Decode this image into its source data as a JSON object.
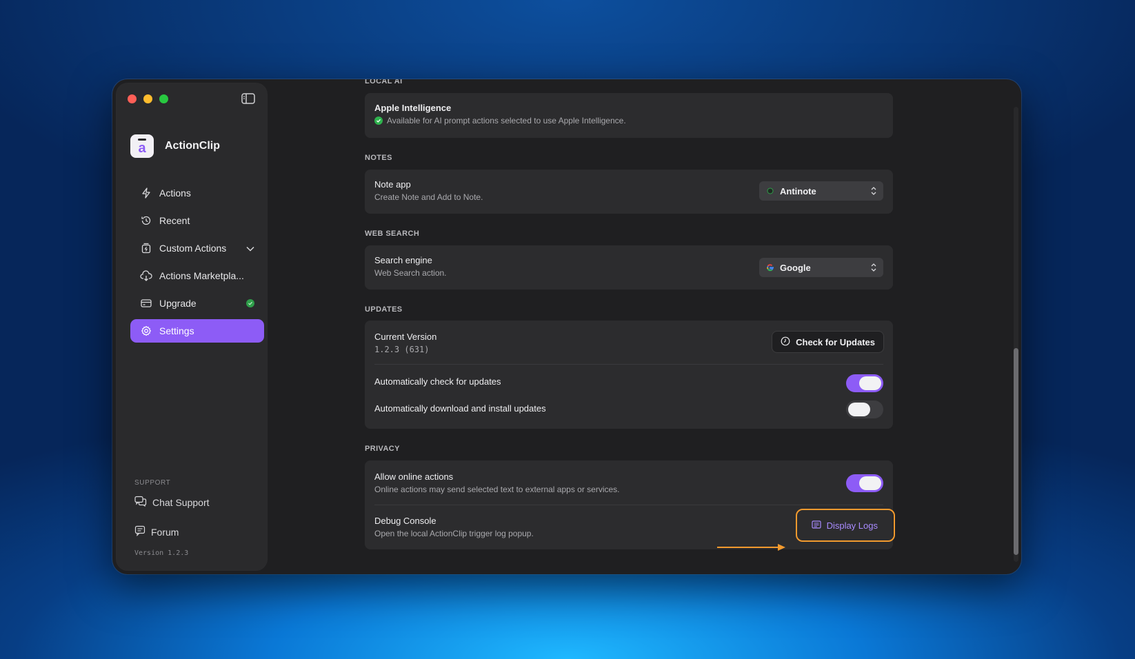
{
  "app": {
    "name": "ActionClip",
    "version_label": "Version 1.2.3"
  },
  "sidebar": {
    "items": [
      {
        "label": "Actions",
        "icon": "lightning-icon"
      },
      {
        "label": "Recent",
        "icon": "clock-history-icon"
      },
      {
        "label": "Custom Actions",
        "icon": "custom-actions-icon"
      },
      {
        "label": "Actions Marketpla...",
        "icon": "cloud-download-icon"
      },
      {
        "label": "Upgrade",
        "icon": "card-icon"
      },
      {
        "label": "Settings",
        "icon": "gear-icon",
        "active": true
      }
    ],
    "support_title": "SUPPORT",
    "support_items": [
      {
        "label": "Chat Support",
        "icon": "chat-icon"
      },
      {
        "label": "Forum",
        "icon": "forum-icon"
      }
    ]
  },
  "sections": {
    "local_ai": {
      "title": "LOCAL AI",
      "row_title": "Apple Intelligence",
      "row_sub": "Available for AI prompt actions selected to use Apple Intelligence."
    },
    "notes": {
      "title": "NOTES",
      "row_title": "Note app",
      "row_sub": "Create Note and Add to Note.",
      "selected": "Antinote"
    },
    "web_search": {
      "title": "WEB SEARCH",
      "row_title": "Search engine",
      "row_sub": "Web Search action.",
      "selected": "Google"
    },
    "updates": {
      "title": "UPDATES",
      "current_version_label": "Current Version",
      "current_version_value": "1.2.3 (631)",
      "check_button": "Check for Updates",
      "auto_check_label": "Automatically check for updates",
      "auto_check_on": true,
      "auto_install_label": "Automatically download and install updates",
      "auto_install_on": false
    },
    "privacy": {
      "title": "PRIVACY",
      "online_title": "Allow online actions",
      "online_sub": "Online actions may send selected text to external apps or services.",
      "online_on": true,
      "debug_title": "Debug Console",
      "debug_sub": "Open the local ActionClip trigger log popup.",
      "display_logs": "Display Logs"
    }
  },
  "colors": {
    "accent": "#8d5cf6",
    "highlight": "#f29a2e",
    "status_green": "#2f9e4a"
  }
}
